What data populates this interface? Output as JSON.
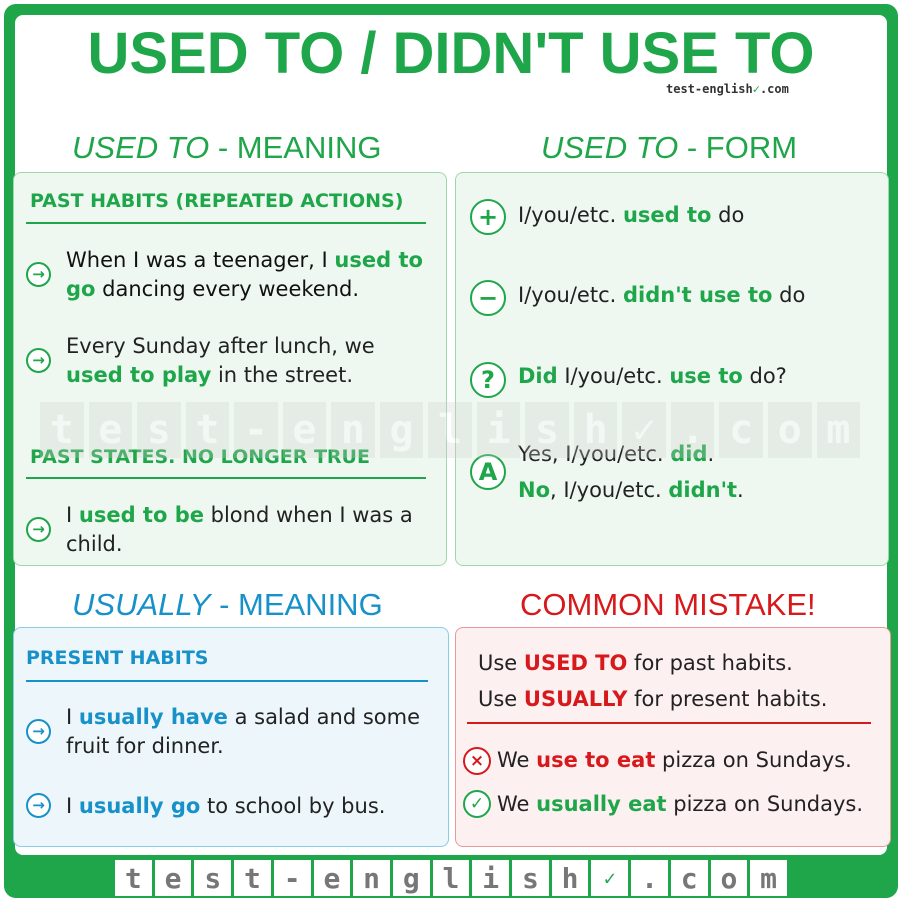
{
  "title": "USED TO / DIDN'T USE TO",
  "brand": {
    "text": "test-english",
    "check": "✓",
    "suffix": "com"
  },
  "colors": {
    "green": "#1fa64a",
    "blue": "#1891c8",
    "red": "#d7191c"
  },
  "meaning": {
    "title_em": "USED TO",
    "title_rest": " - MEANING",
    "past_habits": {
      "heading": "PAST HABITS (REPEATED ACTIONS)",
      "examples": [
        {
          "pre": "When I was a teenager, I ",
          "hl": "used to go",
          "post": " dancing every weekend."
        },
        {
          "pre": "Every Sunday after lunch, we ",
          "hl": "used to play",
          "post": " in the street."
        }
      ]
    },
    "past_states": {
      "heading": "PAST STATES. NO LONGER TRUE",
      "examples": [
        {
          "pre": "I ",
          "hl": "used to be",
          "post": " blond when I was a child."
        }
      ]
    }
  },
  "form": {
    "title_em": "USED TO",
    "title_rest": " - FORM",
    "rows": [
      {
        "icon": "+",
        "pre": "I/you/etc. ",
        "hl": "used to",
        "post": " do"
      },
      {
        "icon": "−",
        "pre": "I/you/etc. ",
        "hl": "didn't use to",
        "post": " do"
      },
      {
        "icon": "?",
        "hl1": "Did",
        "mid": " I/you/etc. ",
        "hl2": "use to",
        "post": " do?"
      },
      {
        "icon": "A",
        "line1_pre": "Yes, I/you/etc. ",
        "line1_hl": "did",
        "line1_post": ".",
        "line2_hl": "No",
        "line2_mid": ", I/you/etc. ",
        "line2_hl2": "didn't",
        "line2_post": "."
      }
    ]
  },
  "usually": {
    "title_em": "USUALLY",
    "title_rest": " - MEANING",
    "heading": "PRESENT HABITS",
    "examples": [
      {
        "pre": "I ",
        "hl": "usually have",
        "post": " a salad and some fruit for dinner."
      },
      {
        "pre": "I ",
        "hl": "usually go",
        "post": " to school by bus."
      }
    ]
  },
  "mistake": {
    "title": "COMMON MISTAKE!",
    "rule1": {
      "pre": "Use ",
      "hl": "USED TO",
      "post": " for past habits."
    },
    "rule2": {
      "pre": "Use ",
      "hl": "USUALLY",
      "post": " for present habits."
    },
    "wrong": {
      "icon": "×",
      "pre": "We ",
      "hl": "use to eat",
      "post": " pizza on Sundays."
    },
    "right": {
      "icon": "✓",
      "pre": "We ",
      "hl": "usually eat",
      "post": " pizza on Sundays."
    }
  },
  "icons": {
    "arrow": "→"
  },
  "watermark": [
    "t",
    "e",
    "s",
    "t",
    "-",
    "e",
    "n",
    "g",
    "l",
    "i",
    "s",
    "h",
    "✓",
    ".",
    "c",
    "o",
    "m"
  ],
  "footer": [
    "t",
    "e",
    "s",
    "t",
    "-",
    "e",
    "n",
    "g",
    "l",
    "i",
    "s",
    "h",
    "✓",
    ".",
    "c",
    "o",
    "m"
  ]
}
